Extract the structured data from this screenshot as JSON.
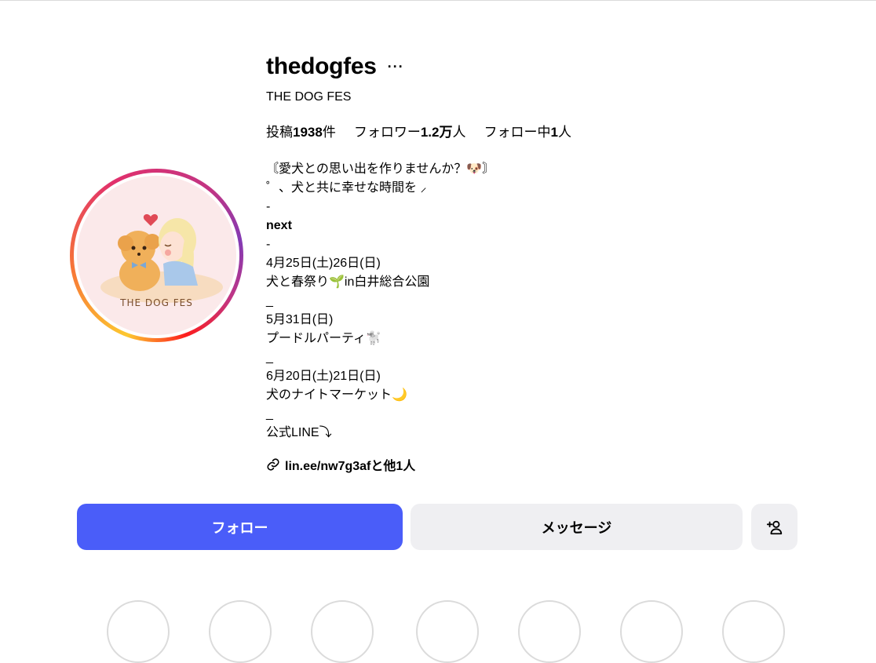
{
  "profile": {
    "username": "thedogfes",
    "more": "···",
    "full_name": "THE DOG FES",
    "avatar_logo_text": "THE DOG FES"
  },
  "stats": [
    {
      "prefix": "投稿",
      "value": "1938",
      "suffix": "件"
    },
    {
      "prefix": "フォロワー",
      "value": "1.2万",
      "suffix": "人"
    },
    {
      "prefix": "フォロー中",
      "value": "1",
      "suffix": "人"
    }
  ],
  "bio": [
    "〘愛犬との思い出を作りませんか？🐶〙",
    "゜、犬と共に幸せな時間を ⸝",
    "-",
    "next",
    "-",
    "4月25日(土)26日(日)",
    "犬と春祭り🌱in白井総合公園",
    "_",
    "5月31日(日)",
    "プードルパーティ🐩",
    "_",
    "6月20日(土)21日(日)",
    "犬のナイトマーケット🌙",
    "_",
    "公式LINE⤵︎"
  ],
  "link": {
    "text": "lin.ee/nw7g3afと他1人",
    "icon": "link-icon"
  },
  "buttons": {
    "follow": "フォロー",
    "message": "メッセージ",
    "suggest_icon": "add-person-icon"
  },
  "colors": {
    "follow_button": "#4a5df9",
    "secondary_button": "#efeff2",
    "avatar_bg": "#fbe9ea"
  }
}
